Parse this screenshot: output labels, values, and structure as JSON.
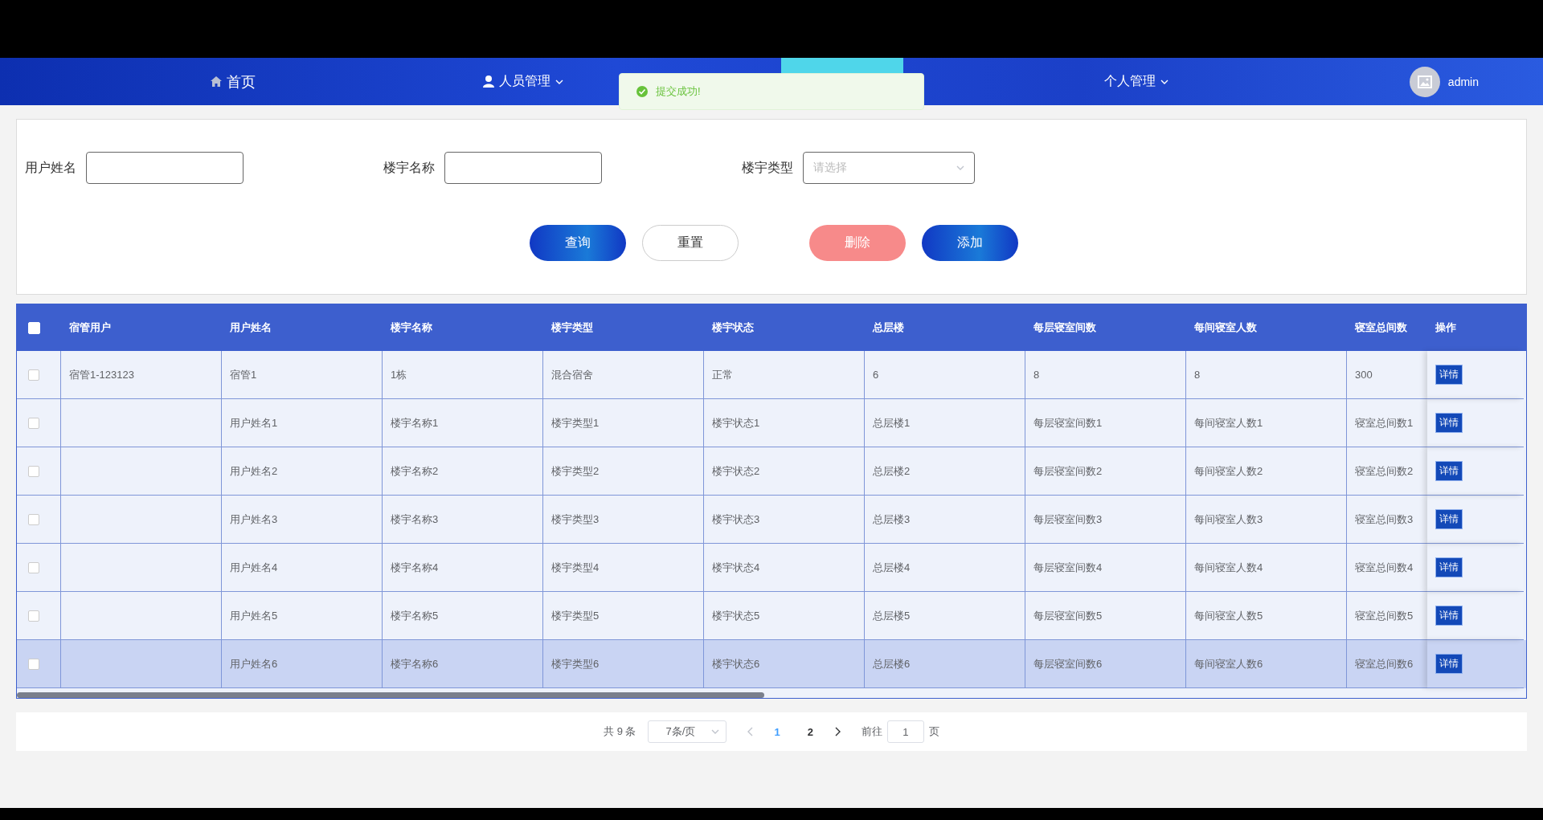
{
  "nav": {
    "items": [
      {
        "kind": "home",
        "label": "首页",
        "dropdown": false
      },
      {
        "kind": "user",
        "label": "人员管理",
        "dropdown": true
      },
      {
        "kind": "active"
      },
      {
        "kind": "plain",
        "label": "个人管理",
        "dropdown": true
      }
    ],
    "user": "admin"
  },
  "toast": {
    "kind": "success",
    "text": "提交成功!"
  },
  "filters": [
    {
      "kind": "input",
      "label": "用户姓名"
    },
    {
      "kind": "input",
      "label": "楼宇名称"
    },
    {
      "kind": "select",
      "label": "楼宇类型",
      "placeholder": "请选择"
    }
  ],
  "buttons": [
    {
      "kind": "primary",
      "label": "查询"
    },
    {
      "kind": "default",
      "label": "重置"
    },
    {
      "kind": "danger",
      "label": "删除"
    },
    {
      "kind": "primary",
      "label": "添加"
    }
  ],
  "table": {
    "all_checked": false,
    "columns": [
      "宿管用户",
      "用户姓名",
      "楼宇名称",
      "楼宇类型",
      "楼宇状态",
      "总层楼",
      "每层寝室间数",
      "每间寝室人数",
      "寝室总间数",
      "操作"
    ],
    "rows": [
      {
        "checked": false,
        "hovered": false,
        "cells": [
          "宿管1-123123",
          "宿管1",
          "1栋",
          "混合宿舍",
          "正常",
          "6",
          "8",
          "8",
          "300"
        ],
        "action": "详情"
      },
      {
        "checked": false,
        "hovered": false,
        "cells": [
          "",
          "用户姓名1",
          "楼宇名称1",
          "楼宇类型1",
          "楼宇状态1",
          "总层楼1",
          "每层寝室间数1",
          "每间寝室人数1",
          "寝室总间数1"
        ],
        "action": "详情"
      },
      {
        "checked": false,
        "hovered": false,
        "cells": [
          "",
          "用户姓名2",
          "楼宇名称2",
          "楼宇类型2",
          "楼宇状态2",
          "总层楼2",
          "每层寝室间数2",
          "每间寝室人数2",
          "寝室总间数2"
        ],
        "action": "详情"
      },
      {
        "checked": false,
        "hovered": false,
        "cells": [
          "",
          "用户姓名3",
          "楼宇名称3",
          "楼宇类型3",
          "楼宇状态3",
          "总层楼3",
          "每层寝室间数3",
          "每间寝室人数3",
          "寝室总间数3"
        ],
        "action": "详情"
      },
      {
        "checked": false,
        "hovered": false,
        "cells": [
          "",
          "用户姓名4",
          "楼宇名称4",
          "楼宇类型4",
          "楼宇状态4",
          "总层楼4",
          "每层寝室间数4",
          "每间寝室人数4",
          "寝室总间数4"
        ],
        "action": "详情"
      },
      {
        "checked": false,
        "hovered": false,
        "cells": [
          "",
          "用户姓名5",
          "楼宇名称5",
          "楼宇类型5",
          "楼宇状态5",
          "总层楼5",
          "每层寝室间数5",
          "每间寝室人数5",
          "寝室总间数5"
        ],
        "action": "详情"
      },
      {
        "checked": false,
        "hovered": true,
        "cells": [
          "",
          "用户姓名6",
          "楼宇名称6",
          "楼宇类型6",
          "楼宇状态6",
          "总层楼6",
          "每层寝室间数6",
          "每间寝室人数6",
          "寝室总间数6"
        ],
        "action": "详情"
      }
    ]
  },
  "pagination": {
    "total": "共 9 条",
    "page_size": "7条/页",
    "pages": [
      {
        "label": "1",
        "selected": true
      },
      {
        "label": "2",
        "selected": false
      }
    ],
    "goto_label": "前往",
    "goto_value": "1",
    "goto_suffix": "页"
  }
}
